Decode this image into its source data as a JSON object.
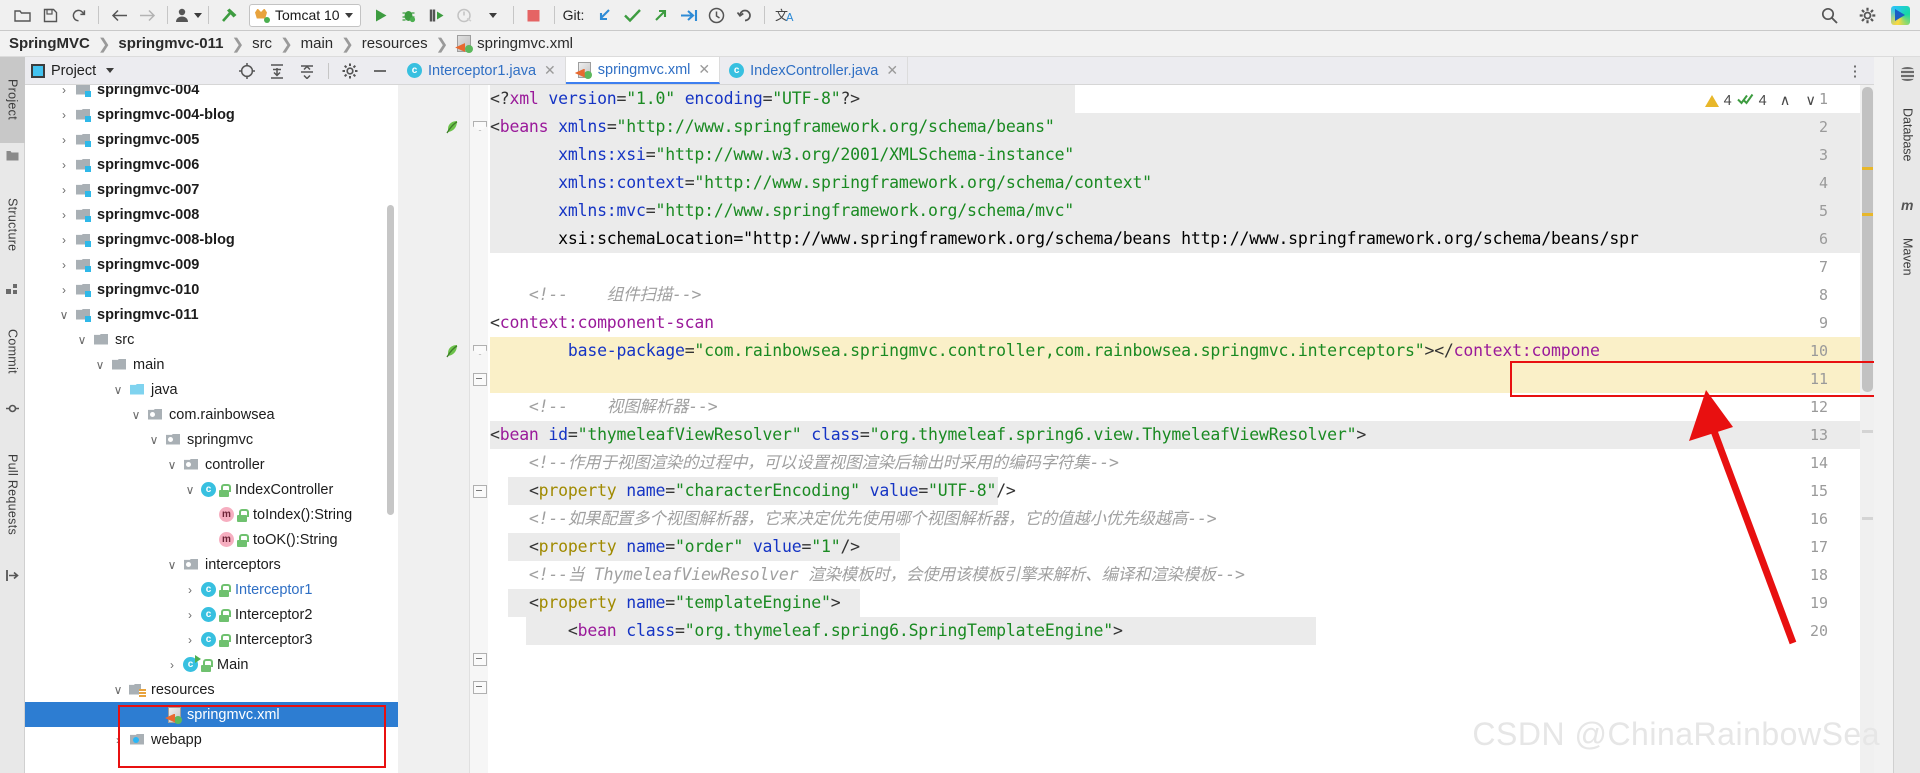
{
  "toolbar": {
    "icons": [
      "open-folder-icon",
      "save-icon",
      "sync-icon",
      "back-arrow-icon",
      "forward-arrow-icon",
      "profiler-icon",
      "build-hammer-icon"
    ],
    "run_config": "Tomcat 10",
    "run_icons": [
      "run-icon",
      "debug-icon",
      "run-with-coverage-icon",
      "profile-icon",
      "stop-icon"
    ],
    "git_label": "Git:",
    "git_icons": [
      "update-project-icon",
      "commit-checkmark-icon",
      "push-icon",
      "rebase-icon",
      "history-clock-icon",
      "rollback-icon",
      "translate-icon"
    ],
    "right_icons": [
      "search-icon",
      "gear-icon",
      "ide-logo-icon"
    ]
  },
  "breadcrumb": {
    "items": [
      {
        "label": "SpringMVC",
        "bold": true
      },
      {
        "label": "springmvc-011",
        "bold": true
      },
      {
        "label": "src",
        "bold": false
      },
      {
        "label": "main",
        "bold": false
      },
      {
        "label": "resources",
        "bold": false
      },
      {
        "label": "springmvc.xml",
        "bold": false,
        "icon": "xml-file-icon"
      }
    ],
    "separator": "❯"
  },
  "left_rail": {
    "tabs": [
      {
        "label": "Project",
        "active": true,
        "icon": "project-folder-icon"
      },
      {
        "label": "Structure",
        "active": false,
        "icon": "structure-icon"
      },
      {
        "label": "Commit",
        "active": false,
        "icon": "commit-icon"
      },
      {
        "label": "Pull Requests",
        "active": false,
        "icon": "pull-request-icon"
      }
    ]
  },
  "right_rail": {
    "tabs": [
      {
        "label": "Database",
        "icon": "database-icon"
      },
      {
        "label": "Maven",
        "icon": "maven-m-icon"
      }
    ]
  },
  "project_panel": {
    "title": "Project",
    "header_icons": [
      "select-opened-file-icon",
      "expand-all-icon",
      "collapse-all-icon",
      "gear-icon",
      "hide-icon"
    ],
    "tree": [
      {
        "label": "springmvc-004",
        "indent": 1,
        "twisty": "›",
        "icon": "module-icon",
        "bold": true
      },
      {
        "label": "springmvc-004-blog",
        "indent": 1,
        "twisty": "›",
        "icon": "module-icon",
        "bold": true
      },
      {
        "label": "springmvc-005",
        "indent": 1,
        "twisty": "›",
        "icon": "module-icon",
        "bold": true
      },
      {
        "label": "springmvc-006",
        "indent": 1,
        "twisty": "›",
        "icon": "module-icon",
        "bold": true
      },
      {
        "label": "springmvc-007",
        "indent": 1,
        "twisty": "›",
        "icon": "module-icon",
        "bold": true
      },
      {
        "label": "springmvc-008",
        "indent": 1,
        "twisty": "›",
        "icon": "module-icon",
        "bold": true
      },
      {
        "label": "springmvc-008-blog",
        "indent": 1,
        "twisty": "›",
        "icon": "module-icon",
        "bold": true
      },
      {
        "label": "springmvc-009",
        "indent": 1,
        "twisty": "›",
        "icon": "module-icon",
        "bold": true
      },
      {
        "label": "springmvc-010",
        "indent": 1,
        "twisty": "›",
        "icon": "module-icon",
        "bold": true
      },
      {
        "label": "springmvc-011",
        "indent": 1,
        "twisty": "∨",
        "icon": "module-icon",
        "bold": true
      },
      {
        "label": "src",
        "indent": 2,
        "twisty": "∨",
        "icon": "folder-icon",
        "bold": false
      },
      {
        "label": "main",
        "indent": 3,
        "twisty": "∨",
        "icon": "folder-icon",
        "bold": false
      },
      {
        "label": "java",
        "indent": 4,
        "twisty": "∨",
        "icon": "source-folder-icon",
        "bold": false
      },
      {
        "label": "com.rainbowsea",
        "indent": 5,
        "twisty": "∨",
        "icon": "package-icon",
        "bold": false
      },
      {
        "label": "springmvc",
        "indent": 6,
        "twisty": "∨",
        "icon": "package-icon",
        "bold": false
      },
      {
        "label": "controller",
        "indent": 7,
        "twisty": "∨",
        "icon": "package-icon",
        "bold": false
      },
      {
        "label": "IndexController",
        "indent": 8,
        "twisty": "∨",
        "icon": "java-class-icon",
        "bold": false
      },
      {
        "label": "toIndex():String",
        "indent": 9,
        "twisty": "",
        "icon": "java-method-icon",
        "bold": false
      },
      {
        "label": "toOK():String",
        "indent": 9,
        "twisty": "",
        "icon": "java-method-icon",
        "bold": false
      },
      {
        "label": "interceptors",
        "indent": 7,
        "twisty": "∨",
        "icon": "package-icon",
        "bold": false
      },
      {
        "label": "Interceptor1",
        "indent": 8,
        "twisty": "›",
        "icon": "java-class-icon",
        "bold": false,
        "blue": true
      },
      {
        "label": "Interceptor2",
        "indent": 8,
        "twisty": "›",
        "icon": "java-class-icon",
        "bold": false
      },
      {
        "label": "Interceptor3",
        "indent": 8,
        "twisty": "›",
        "icon": "java-class-icon",
        "bold": false
      },
      {
        "label": "Main",
        "indent": 7,
        "twisty": "›",
        "icon": "java-main-class-icon",
        "bold": false
      },
      {
        "label": "resources",
        "indent": 4,
        "twisty": "∨",
        "icon": "resources-folder-icon",
        "bold": false
      },
      {
        "label": "springmvc.xml",
        "indent": 6,
        "twisty": "",
        "icon": "xml-file-icon",
        "bold": false,
        "selected": true
      },
      {
        "label": "webapp",
        "indent": 4,
        "twisty": "›",
        "icon": "webapp-folder-icon",
        "bold": false
      }
    ]
  },
  "editor_tabs": [
    {
      "label": "Interceptor1.java",
      "icon": "java-class-icon",
      "active": false,
      "close": "✕"
    },
    {
      "label": "springmvc.xml",
      "icon": "xml-file-icon",
      "active": true,
      "close": "✕"
    },
    {
      "label": "IndexController.java",
      "icon": "java-class-icon",
      "active": false,
      "close": "✕"
    }
  ],
  "editor_tabs_more": "⋮",
  "inspection": {
    "warning_count": "4",
    "weak_warning_count": "4",
    "up_arrow": "∧",
    "down_arrow": "∨"
  },
  "code": {
    "language": "xml",
    "file": "springmvc.xml",
    "lines": [
      {
        "n": 1,
        "text": "<?xml version=\"1.0\" encoding=\"UTF-8\"?>"
      },
      {
        "n": 2,
        "text": "<beans xmlns=\"http://www.springframework.org/schema/beans\""
      },
      {
        "n": 3,
        "text": "       xmlns:xsi=\"http://www.w3.org/2001/XMLSchema-instance\""
      },
      {
        "n": 4,
        "text": "       xmlns:context=\"http://www.springframework.org/schema/context\""
      },
      {
        "n": 5,
        "text": "       xmlns:mvc=\"http://www.springframework.org/schema/mvc\""
      },
      {
        "n": 6,
        "text": "       xsi:schemaLocation=\"http://www.springframework.org/schema/beans http://www.springframework.org/schema/beans/spr"
      },
      {
        "n": 7,
        "text": ""
      },
      {
        "n": 8,
        "text": "    <!--    组件扫描-->"
      },
      {
        "n": 9,
        "text": "<context:component-scan"
      },
      {
        "n": 10,
        "text": "        base-package=\"com.rainbowsea.springmvc.controller,com.rainbowsea.springmvc.interceptors\"></context:compone"
      },
      {
        "n": 11,
        "text": ""
      },
      {
        "n": 12,
        "text": "    <!--    视图解析器-->"
      },
      {
        "n": 13,
        "text": "<bean id=\"thymeleafViewResolver\" class=\"org.thymeleaf.spring6.view.ThymeleafViewResolver\">"
      },
      {
        "n": 14,
        "text": "    <!--作用于视图渲染的过程中，可以设置视图渲染后输出时采用的编码字符集-->"
      },
      {
        "n": 15,
        "text": "    <property name=\"characterEncoding\" value=\"UTF-8\"/>"
      },
      {
        "n": 16,
        "text": "    <!--如果配置多个视图解析器，它来决定优先使用哪个视图解析器，它的值越小优先级越高-->"
      },
      {
        "n": 17,
        "text": "    <property name=\"order\" value=\"1\"/>"
      },
      {
        "n": 18,
        "text": "    <!--当 ThymeleafViewResolver 渲染模板时，会使用该模板引擎来解析、编译和渲染模板-->"
      },
      {
        "n": 19,
        "text": "    <property name=\"templateEngine\">"
      },
      {
        "n": 20,
        "text": "        <bean class=\"org.thymeleaf.spring6.SpringTemplateEngine\">"
      }
    ],
    "highlighted_fragment": "com.rainbowsea.springmvc.interceptors",
    "highlight_color": "#e81010",
    "yellow_highlight_lines": [
      9,
      10
    ]
  },
  "annotations": {
    "arrow_color": "#e81010",
    "rect_code": "highlight-rect-interceptors-package",
    "rect_tree": "highlight-rect-resources-springmvc-xml"
  },
  "watermark": "CSDN @ChinaRainbowSea"
}
